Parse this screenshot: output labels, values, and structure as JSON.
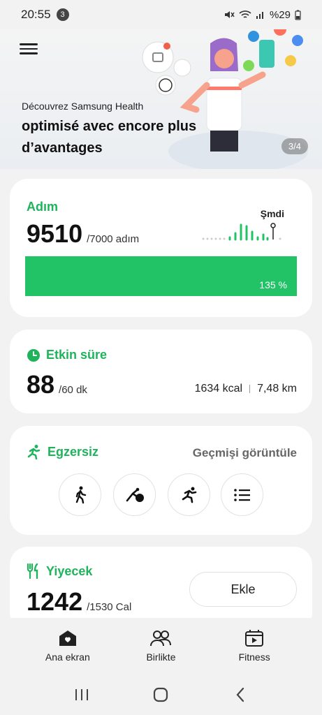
{
  "status_bar": {
    "time": "20:55",
    "notifications": "3",
    "battery": "%29"
  },
  "banner": {
    "subtitle": "Découvrez Samsung Health",
    "title": "optimisé avec encore plus d’avantages",
    "page_indicator": "3/4"
  },
  "steps": {
    "title": "Adım",
    "value": "9510",
    "goal": "/7000 adım",
    "now_label": "Şmdi",
    "progress_percent": 135,
    "progress_label": "135 %"
  },
  "active_time": {
    "title": "Etkin süre",
    "value": "88",
    "goal": "/60 dk",
    "calories": "1634 kcal",
    "distance": "7,48 km"
  },
  "exercise": {
    "title": "Egzersiz",
    "history_link": "Geçmişi görüntüle",
    "buttons": [
      "walking-icon",
      "yoga-icon",
      "running-icon",
      "list-icon"
    ]
  },
  "food": {
    "title": "Yiyecek",
    "value": "1242",
    "goal": "/1530 Cal",
    "add_button": "Ekle"
  },
  "bottom_nav": {
    "home": "Ana ekran",
    "together": "Birlikte",
    "fitness": "Fitness"
  },
  "colors": {
    "accent": "#1fb35b",
    "progress": "#22c266"
  }
}
